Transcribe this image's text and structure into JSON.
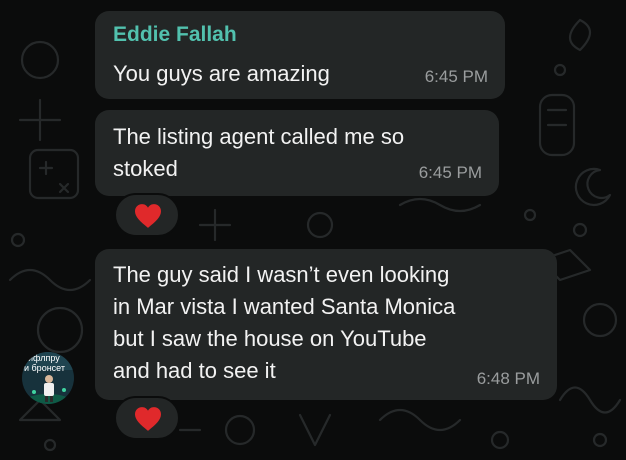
{
  "chat": {
    "messages": [
      {
        "sender": "Eddie Fallah",
        "text": "You guys are amazing",
        "time": "6:45 PM"
      },
      {
        "text": "The listing agent called me so\nstoked",
        "time": "6:45 PM",
        "reaction": "heart"
      },
      {
        "text": "The guy said I wasn’t even looking\nin Mar vista I wanted Santa Monica\nbut I saw the house on YouTube\nand had to see it",
        "time": "6:48 PM",
        "reaction": "heart"
      }
    ],
    "avatar": {
      "line1": "ифлпру",
      "line2": "и брoнсет"
    }
  },
  "colors": {
    "sender_name": "#52c1ae",
    "bubble": "#232626",
    "background": "#0b0c0c",
    "heart": "#e0292b"
  }
}
